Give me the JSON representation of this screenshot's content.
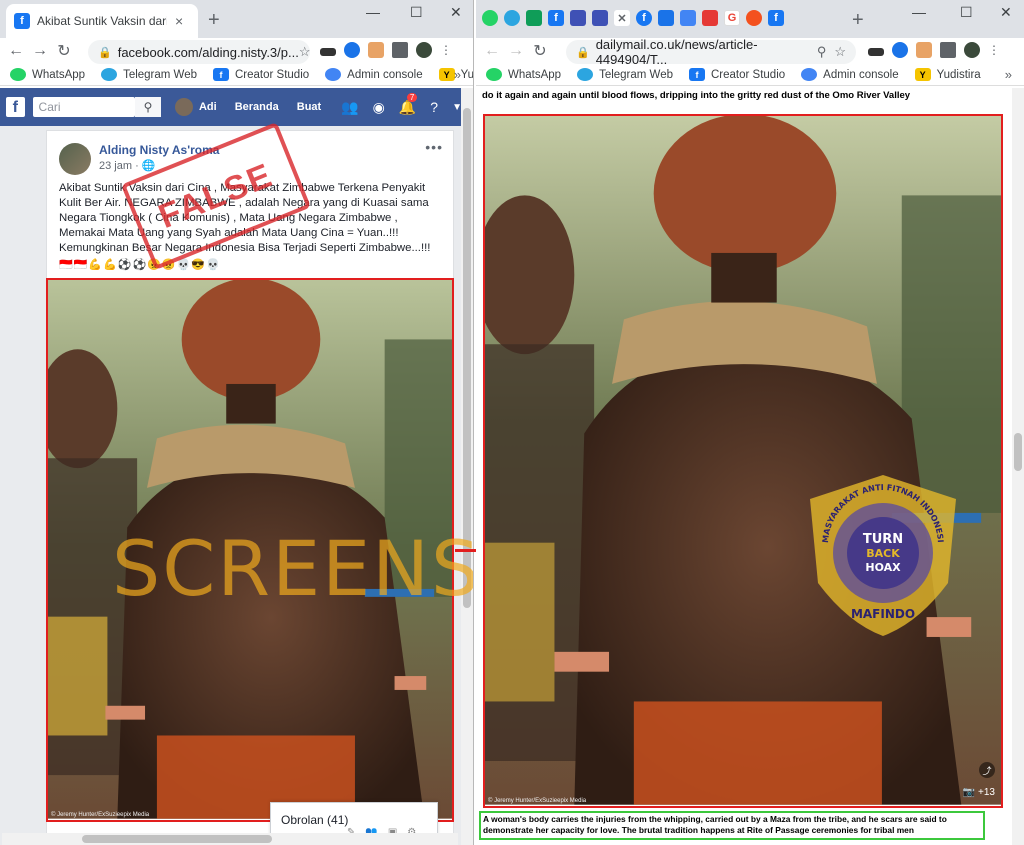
{
  "left_window": {
    "tab": {
      "title": "Akibat Suntik Vaksin dari Cina , M",
      "close": "×"
    },
    "new_tab": "+",
    "url": "facebook.com/alding.nisty.3/p...",
    "bookmarks": [
      {
        "label": "WhatsApp",
        "icon": "whatsapp-icon",
        "color": "#25d366"
      },
      {
        "label": "Telegram Web",
        "icon": "telegram-icon",
        "color": "#2ca5e0"
      },
      {
        "label": "Creator Studio",
        "icon": "facebook-icon",
        "color": "#1877f2"
      },
      {
        "label": "Admin console",
        "icon": "admin-icon",
        "color": "#4285f4"
      },
      {
        "label": "Yudistira",
        "icon": "yudistira-icon",
        "color": "#f5c400"
      }
    ],
    "facebook": {
      "search_placeholder": "Cari",
      "user_name": "Adi",
      "nav_home": "Beranda",
      "nav_create": "Buat",
      "notification_count": "7",
      "brand_color": "#3b5998"
    },
    "post": {
      "author": "Alding Nisty As'roma",
      "time": "23 jam ·",
      "text_lines": [
        "Akibat Suntik Vaksin dari Cina , Masyarakat Zimbabwe Terkena Penyakit",
        "Kulit Ber Air. NEGARA ZIMBABWE , adalah Negara yang di Kuasai sama",
        "Negara Tiongkok ( Cina Komunis) , Mata Uang Negara Zimbabwe ,",
        "Memakai Mata Uang yang Syah adalah Mata Uang Cina = Yuan..!!!",
        "Kemungkinan Besar Negara Indonesia Bisa Terjadi Seperti Zimbabwe...!!!"
      ],
      "emojis": "🇮🇩🇮🇩💪💪⚽⚽😠😠💀😎💀",
      "photo_credit": "© Jeremy Hunter/ExSuzieepix Media",
      "stamp_text": "FALSE",
      "chat_label": "Obrolan (41)"
    },
    "watermark_text": "SCREENSHOT BY"
  },
  "right_window": {
    "url": "dailymail.co.uk/news/article-4494904/T...",
    "new_tab": "+",
    "bookmarks": [
      {
        "label": "WhatsApp",
        "icon": "whatsapp-icon",
        "color": "#25d366"
      },
      {
        "label": "Telegram Web",
        "icon": "telegram-icon",
        "color": "#2ca5e0"
      },
      {
        "label": "Creator Studio",
        "icon": "facebook-icon",
        "color": "#1877f2"
      },
      {
        "label": "Admin console",
        "icon": "admin-icon",
        "color": "#4285f4"
      },
      {
        "label": "Yudistira",
        "icon": "yudistira-icon",
        "color": "#f5c400"
      }
    ],
    "article_text_top": "do it again and again until blood flows, dripping into the gritty red dust of the Omo River Valley",
    "photo_credit": "© Jeremy Hunter/ExSuzieepix Media",
    "photo_count": "+13",
    "caption": "A woman's body carries the injuries from the whipping, carried out by a Maza from the tribe, and he scars are said to demonstrate her capacity for love. The brutal tradition happens at Rite of Passage ceremonies for tribal men",
    "badge": {
      "ring_text": "MASYARAKAT ANTI FITNAH INDONESIA",
      "center_line1": "TURN",
      "center_line2": "BACK",
      "center_line3": "HOAX",
      "bottom_text": "MAFINDO"
    }
  }
}
